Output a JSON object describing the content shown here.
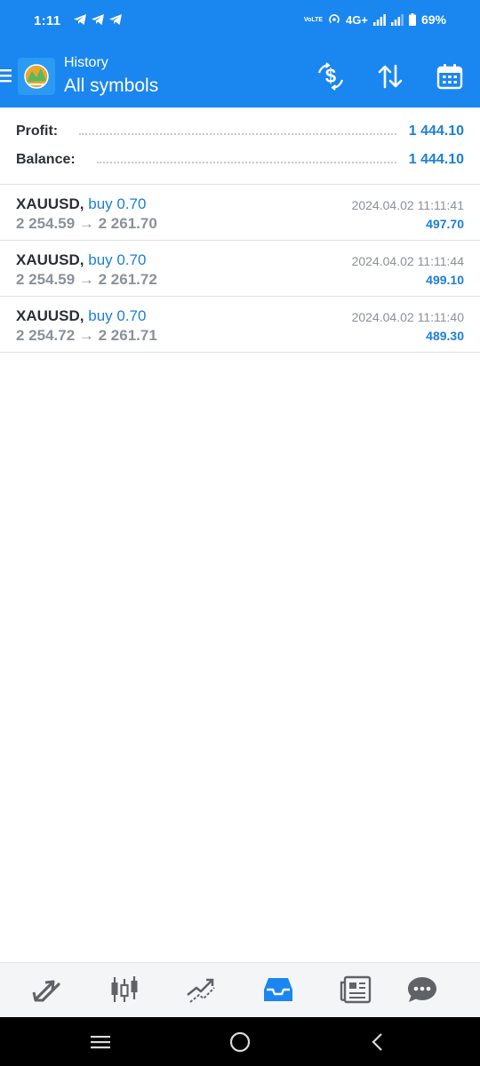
{
  "status_bar": {
    "time": "1:11",
    "network": "4G+",
    "volte": "VoLTE",
    "battery": "69%"
  },
  "app_bar": {
    "subtitle": "History",
    "title": "All symbols",
    "actions": [
      "dollar-swap-icon",
      "sort-icon",
      "calendar-icon"
    ]
  },
  "summary": {
    "profit_label": "Profit:",
    "profit_value": "1 444.10",
    "balance_label": "Balance:",
    "balance_value": "1 444.10"
  },
  "deals": [
    {
      "symbol": "XAUUSD",
      "side": "buy 0.70",
      "prices": "2 254.59 → 2 261.70",
      "time": "2024.04.02 11:11:41",
      "profit": "497.70"
    },
    {
      "symbol": "XAUUSD",
      "side": "buy 0.70",
      "prices": "2 254.59 → 2 261.72",
      "time": "2024.04.02 11:11:44",
      "profit": "499.10"
    },
    {
      "symbol": "XAUUSD",
      "side": "buy 0.70",
      "prices": "2 254.72 → 2 261.71",
      "time": "2024.04.02 11:11:40",
      "profit": "489.30"
    }
  ],
  "tabs": [
    {
      "name": "quotes",
      "icon": "arrows-icon",
      "active": false
    },
    {
      "name": "chart",
      "icon": "candlestick-icon",
      "active": false
    },
    {
      "name": "trade",
      "icon": "trend-icon",
      "active": false
    },
    {
      "name": "history",
      "icon": "inbox-icon",
      "active": true
    },
    {
      "name": "news",
      "icon": "news-icon",
      "active": false
    },
    {
      "name": "chat",
      "icon": "chat-icon",
      "active": false
    }
  ],
  "colors": {
    "primary": "#1a86f0",
    "accent_text": "#1a7fd9",
    "muted_text": "#8b9199",
    "dark_text": "#2b3036",
    "active_tab": "#1a86f0",
    "inactive_tab": "#5f6368"
  }
}
